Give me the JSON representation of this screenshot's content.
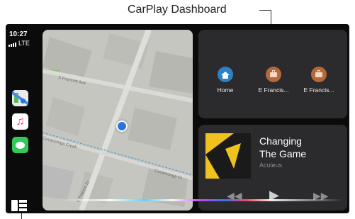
{
  "callout": {
    "label": "CarPlay Dashboard"
  },
  "status": {
    "time": "10:27",
    "network": "LTE"
  },
  "rail": {
    "apps": [
      {
        "name": "maps-app",
        "icon": "maps-icon"
      },
      {
        "name": "music-app",
        "icon": "music-note-icon",
        "glyph": "♫"
      },
      {
        "name": "messages-app",
        "icon": "message-bubble-icon"
      }
    ]
  },
  "map": {
    "streets": [
      "S Fremont Ave",
      "E Francis St",
      "Cucamonga Creek",
      "Cucamonga Cr"
    ]
  },
  "shortcuts": [
    {
      "label": "Home",
      "icon": "home-icon",
      "color": "#2a82c9"
    },
    {
      "label": "E Francis...",
      "icon": "briefcase-icon",
      "color": "#b5693a"
    },
    {
      "label": "E Francis...",
      "icon": "briefcase-icon",
      "color": "#b5693a"
    }
  ],
  "now_playing": {
    "title_line1": "Changing",
    "title_line2": "The Game",
    "artist": "Aculeus",
    "controls": {
      "prev": "◀◀",
      "play": "▶",
      "next": "▶▶"
    }
  },
  "colors": {
    "accent_blue": "#2d73e0",
    "album_yellow": "#f0c21e"
  }
}
